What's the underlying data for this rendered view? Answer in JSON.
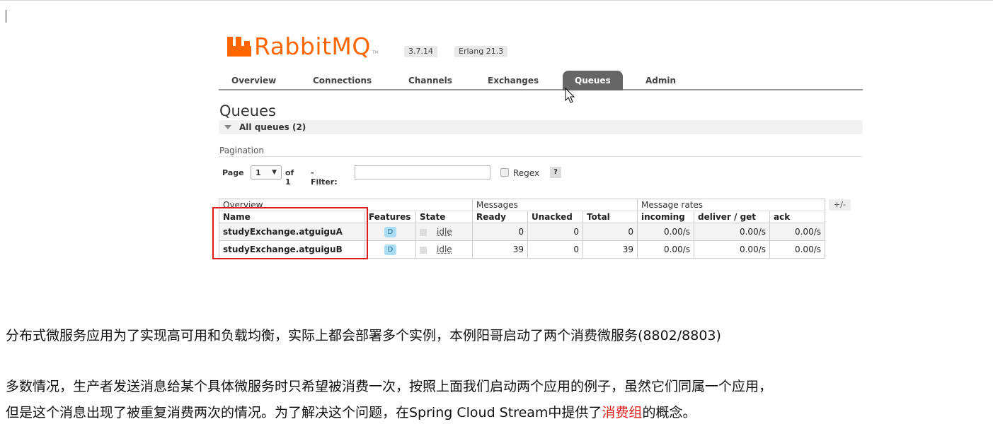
{
  "app": {
    "logo_text": "RabbitMQ",
    "logo_tm": "TM",
    "rabbitmq_version": "3.7.14",
    "erlang_version": "Erlang 21.3",
    "brand_color": "#ff6600"
  },
  "tabs": [
    {
      "label": "Overview",
      "active": false
    },
    {
      "label": "Connections",
      "active": false
    },
    {
      "label": "Channels",
      "active": false
    },
    {
      "label": "Exchanges",
      "active": false
    },
    {
      "label": "Queues",
      "active": true
    },
    {
      "label": "Admin",
      "active": false
    }
  ],
  "page": {
    "title": "Queues",
    "section_label": "All queues (2)"
  },
  "pagination": {
    "heading": "Pagination",
    "page_label": "Page",
    "page_value": "1",
    "of_label": "of 1",
    "filter_label": "- Filter:",
    "filter_value": "",
    "regex_label": "Regex",
    "help_label": "?"
  },
  "table": {
    "groups": {
      "overview": "Overview",
      "messages": "Messages",
      "rates": "Message rates",
      "toggle": "+/-"
    },
    "headers": {
      "name": "Name",
      "features": "Features",
      "state": "State",
      "ready": "Ready",
      "unacked": "Unacked",
      "total": "Total",
      "incoming": "incoming",
      "deliver_get": "deliver / get",
      "ack": "ack"
    },
    "rows": [
      {
        "name": "studyExchange.atguiguA",
        "feature": "D",
        "state": "idle",
        "ready": "0",
        "unacked": "0",
        "total": "0",
        "incoming": "0.00/s",
        "deliver_get": "0.00/s",
        "ack": "0.00/s"
      },
      {
        "name": "studyExchange.atguiguB",
        "feature": "D",
        "state": "idle",
        "ready": "39",
        "unacked": "0",
        "total": "39",
        "incoming": "0.00/s",
        "deliver_get": "0.00/s",
        "ack": "0.00/s"
      }
    ]
  },
  "notes": {
    "p1": "分布式微服务应用为了实现高可用和负载均衡，实际上都会部署多个实例，本例阳哥启动了两个消费微服务(8802/8803)",
    "p2": "多数情况，生产者发送消息给某个具体微服务时只希望被消费一次，按照上面我们启动两个应用的例子，虽然它们同属一个应用，",
    "p3_before": "但是这个消息出现了被重复消费两次的情况。为了解决这个问题，在Spring Cloud Stream中提供了",
    "p3_highlight": "消费组",
    "p3_after": "的概念。",
    "highlight_color": "#e21c1c"
  }
}
